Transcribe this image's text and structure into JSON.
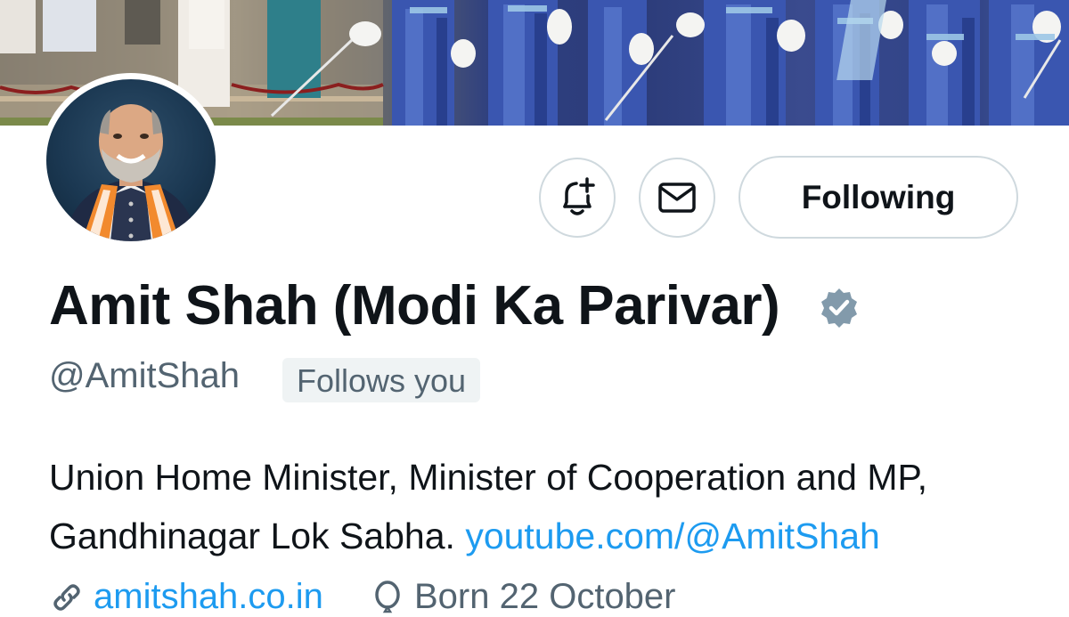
{
  "profile": {
    "display_name": "Amit Shah (Modi Ka Parivar)",
    "handle": "@AmitShah",
    "follows_you_label": "Follows you",
    "verified_color": "#829aab"
  },
  "actions": {
    "notify_icon": "bell-plus-icon",
    "message_icon": "envelope-icon",
    "following_label": "Following"
  },
  "bio": {
    "line1": "Union Home Minister, Minister of Cooperation and MP,",
    "line2_text": "Gandhinagar Lok Sabha.",
    "line2_link": "youtube.com/@AmitShah"
  },
  "meta": {
    "website": "amitshah.co.in",
    "website_icon": "link-icon",
    "birthday": "Born 22 October",
    "birthday_icon": "balloon-icon"
  },
  "colors": {
    "link": "#1d9bf0",
    "text": "#0f1419",
    "secondary": "#536471",
    "border": "#cfd9de"
  }
}
